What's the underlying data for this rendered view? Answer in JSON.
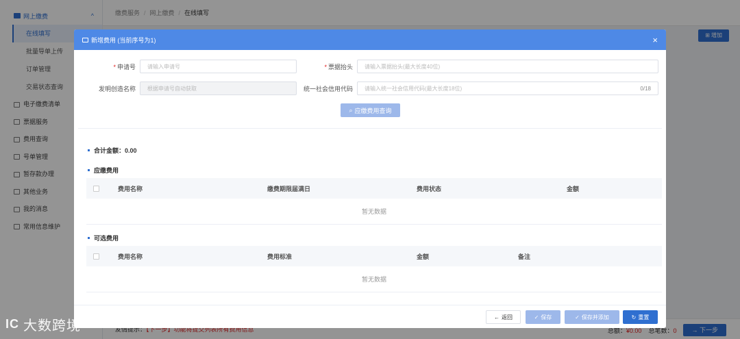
{
  "sidebar": {
    "group_label": "网上缴费",
    "items": [
      "在线填写",
      "批量导单上传",
      "订单管理",
      "交易状态查询"
    ],
    "sections": [
      "电子缴费清单",
      "票据服务",
      "费用查询",
      "号单管理",
      "暂存款办理",
      "其他业务",
      "我的消息",
      "常用信息维护"
    ]
  },
  "breadcrumb": [
    "缴费服务",
    "网上缴费",
    "在线填写"
  ],
  "add_label": "增加",
  "bottom": {
    "tip_prefix": "友情提示：",
    "tip_red": "【下一步】功能将提交列表所有费用信息",
    "total_prefix": "总额：",
    "total_value": "¥0.00",
    "count_prefix": "总笔数：",
    "count_value": "0",
    "next_label": "下一步"
  },
  "modal": {
    "title": "新增费用 (当前序号为1)",
    "close": "×",
    "form": {
      "app_no_label": "申请号",
      "app_no_placeholder": "请输入申请号",
      "invoice_label": "票据抬头",
      "invoice_placeholder": "请输入票据抬头(最大长度40位)",
      "invention_label": "发明创造名称",
      "invention_placeholder": "根据申请号自动获取",
      "credit_label": "统一社会信用代码",
      "credit_placeholder": "请输入统一社会信用代码(最大长度18位)",
      "credit_count": "0/18"
    },
    "query_button": "应缴费用查询",
    "total_label": "合计金额：0.00",
    "due_section": {
      "title": "应缴费用",
      "columns": [
        "费用名称",
        "缴费期限届满日",
        "费用状态",
        "金额"
      ],
      "empty": "暂无数据"
    },
    "optional_section": {
      "title": "可选费用",
      "columns": [
        "费用名称",
        "费用标准",
        "金额",
        "备注"
      ],
      "empty": "暂无数据"
    },
    "footer": {
      "back": "返回",
      "save": "保存",
      "save_add": "保存并添加",
      "reset": "重置"
    }
  },
  "watermark": {
    "logo": "IC",
    "text": "大数跨境"
  },
  "colors": {
    "primary": "#2f6fd0",
    "header": "#4e89e6",
    "disabled_btn": "#9db8ea",
    "required": "#e02020"
  }
}
